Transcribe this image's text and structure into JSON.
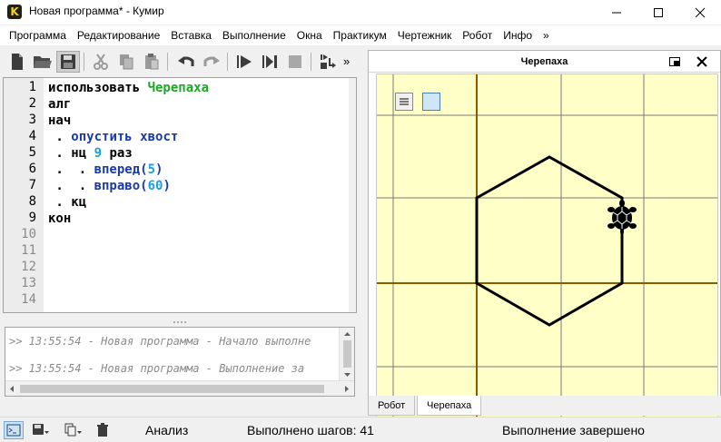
{
  "window": {
    "title": "Новая программа* - Кумир",
    "app_icon_letter": "K"
  },
  "menu": [
    "Программа",
    "Редактирование",
    "Вставка",
    "Выполнение",
    "Окна",
    "Практикум",
    "Чертежник",
    "Робот",
    "Инфо",
    "»"
  ],
  "toolbar": {
    "overflow": "»"
  },
  "editor": {
    "line_numbers": [
      "1",
      "2",
      "3",
      "4",
      "5",
      "6",
      "7",
      "8",
      "9",
      "10",
      "11",
      "12",
      "13",
      "14"
    ],
    "code": [
      [
        {
          "t": "использовать ",
          "c": "kw"
        },
        {
          "t": "Черепаха",
          "c": "mod"
        }
      ],
      [
        {
          "t": "алг",
          "c": "kw"
        }
      ],
      [
        {
          "t": "нач",
          "c": "kw"
        }
      ],
      [
        {
          "t": " . ",
          "c": "dot"
        },
        {
          "t": "опустить хвост",
          "c": "fn"
        }
      ],
      [
        {
          "t": " . ",
          "c": "dot"
        },
        {
          "t": "нц ",
          "c": "kw"
        },
        {
          "t": "9",
          "c": "num"
        },
        {
          "t": " раз",
          "c": "kw"
        }
      ],
      [
        {
          "t": " .  . ",
          "c": "dot"
        },
        {
          "t": "вперед(",
          "c": "fn"
        },
        {
          "t": "5",
          "c": "num"
        },
        {
          "t": ")",
          "c": "par"
        }
      ],
      [
        {
          "t": " .  . ",
          "c": "dot"
        },
        {
          "t": "вправо(",
          "c": "fn"
        },
        {
          "t": "60",
          "c": "num"
        },
        {
          "t": ")",
          "c": "par"
        }
      ],
      [
        {
          "t": " . ",
          "c": "dot"
        },
        {
          "t": "кц",
          "c": "kw"
        }
      ],
      [
        {
          "t": "кон",
          "c": "kw"
        }
      ]
    ]
  },
  "console": {
    "lines": [
      ">> 13:55:54 - Новая программа - Начало выполне",
      ">> 13:55:54 - Новая программа - Выполнение за"
    ]
  },
  "turtle_panel": {
    "title": "Черепаха",
    "tabs": [
      "Робот",
      "Черепаха"
    ],
    "selected_tab": "Черепаха",
    "polygon_sides": 6,
    "turn_degrees": 60,
    "colors": {
      "background": "#ffffc8",
      "axis": "#8b5a00",
      "grid": "#7a7a7a",
      "path": "#000000"
    }
  },
  "status": {
    "mode": "Анализ",
    "steps": "Выполнено шагов: 41",
    "state": "Выполнение завершено"
  }
}
